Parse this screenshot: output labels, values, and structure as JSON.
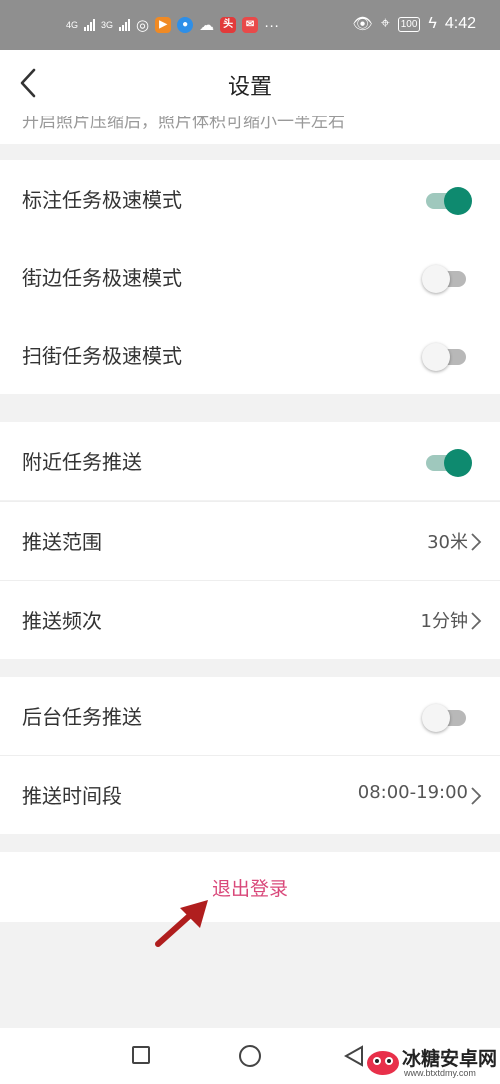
{
  "status_bar": {
    "network_1": "4G",
    "network_2": "3G",
    "overflow": "···",
    "battery": "100",
    "time": "4:42"
  },
  "header": {
    "title": "设置",
    "back_icon": "chevron-left-icon"
  },
  "cutoff_text": "开启照片压缩后，照片体积可缩小一半左右",
  "groups": [
    {
      "rows": [
        {
          "label": "标注任务极速模式",
          "toggle": true
        },
        {
          "label": "街边任务极速模式",
          "toggle": false
        },
        {
          "label": "扫街任务极速模式",
          "toggle": false
        }
      ]
    },
    {
      "rows": [
        {
          "label": "附近任务推送",
          "toggle": true
        },
        {
          "label": "推送范围",
          "value": "30米"
        },
        {
          "label": "推送频次",
          "value": "1分钟"
        }
      ]
    },
    {
      "rows": [
        {
          "label": "后台任务推送",
          "toggle": false
        },
        {
          "label": "推送时间段",
          "value": "08:00-19:00"
        }
      ]
    }
  ],
  "logout_label": "退出登录",
  "watermark": {
    "text": "冰糖安卓网",
    "url": "www.btxtdmy.com"
  },
  "colors": {
    "accent_on": "#0e8a6f",
    "logout": "#d9487a",
    "arrow": "#b01e1e"
  }
}
